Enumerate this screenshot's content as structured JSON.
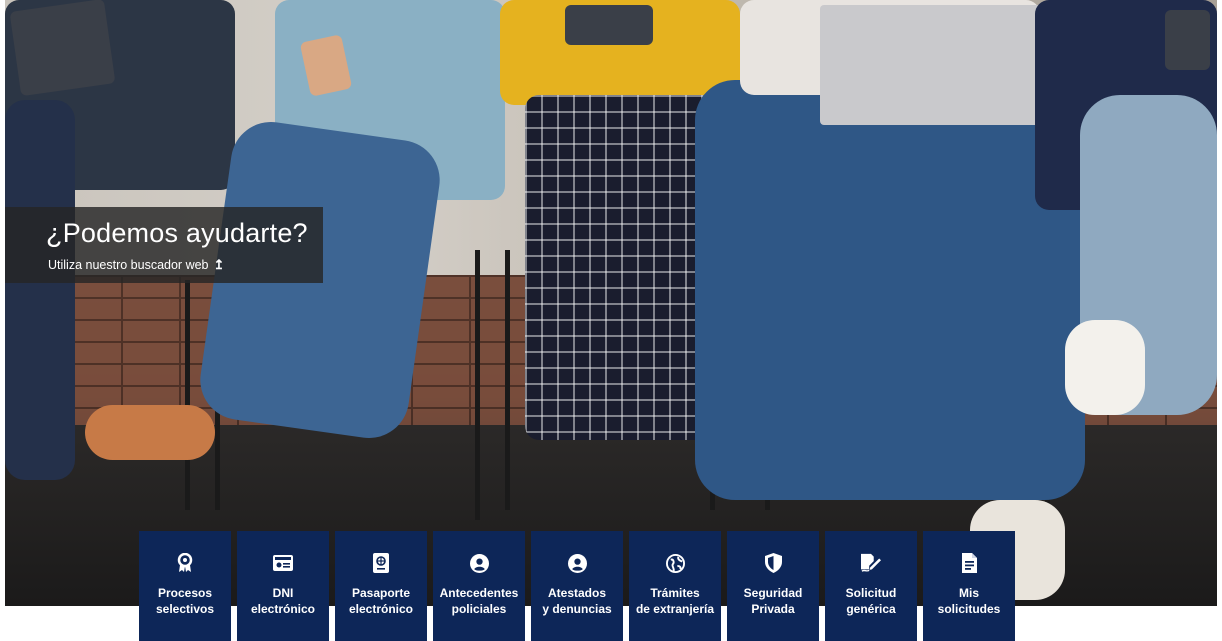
{
  "help": {
    "title": "¿Podemos ayudarte?",
    "subtitle": "Utiliza nuestro buscador web",
    "arrow_icon": "arrow-up-icon"
  },
  "services": [
    {
      "label": "Procesos\nselectivos",
      "icon": "award-icon"
    },
    {
      "label": "DNI\nelectrónico",
      "icon": "id-card-icon"
    },
    {
      "label": "Pasaporte\nelectrónico",
      "icon": "passport-icon"
    },
    {
      "label": "Antecedentes\npoliciales",
      "icon": "user-circle-icon"
    },
    {
      "label": "Atestados\ny denuncias",
      "icon": "user-circle-icon"
    },
    {
      "label": "Trámites\nde extranjería",
      "icon": "globe-icon"
    },
    {
      "label": "Seguridad\nPrivada",
      "icon": "shield-icon"
    },
    {
      "label": "Solicitud\ngenérica",
      "icon": "signature-icon"
    },
    {
      "label": "Mis\nsolicitudes",
      "icon": "document-icon"
    }
  ],
  "colors": {
    "tile_bg": "#0d2658",
    "tile_text": "#ffffff"
  }
}
